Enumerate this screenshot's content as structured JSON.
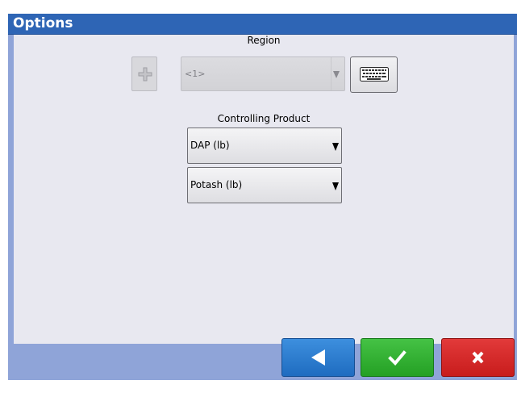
{
  "window": {
    "title": "Options"
  },
  "region": {
    "label": "Region",
    "selected_value": "<1>",
    "add_enabled": false
  },
  "controlling_product": {
    "label": "Controlling Product",
    "products": [
      "DAP (lb)",
      "Potash (lb)"
    ]
  },
  "footer": {
    "back_icon": "back-arrow-icon",
    "confirm_icon": "check-icon",
    "cancel_icon": "close-icon"
  },
  "colors": {
    "title_bar": "#2e65b5",
    "back_button": "#2a7bd0",
    "confirm_button": "#33b033",
    "cancel_button": "#d42828"
  }
}
